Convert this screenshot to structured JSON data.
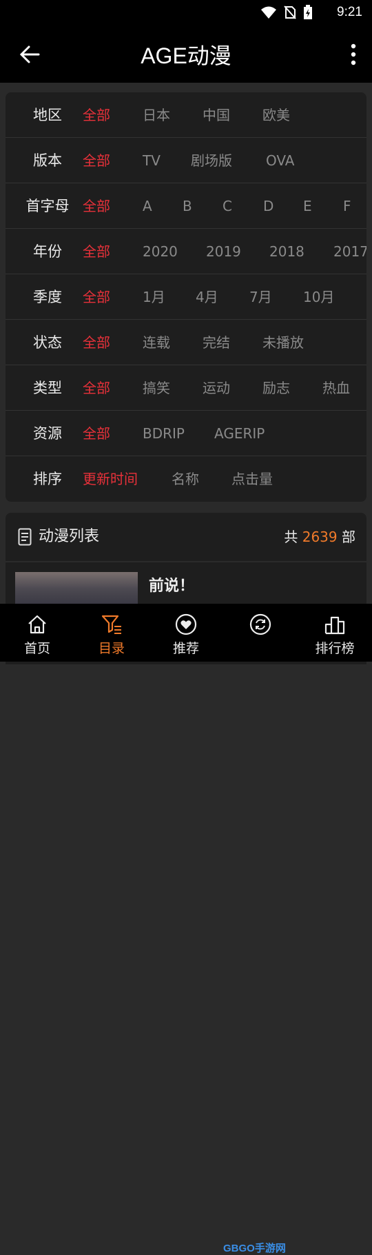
{
  "status": {
    "time": "9:21"
  },
  "app_bar": {
    "title": "AGE动漫"
  },
  "filters": [
    {
      "label": "地区",
      "options": [
        "全部",
        "日本",
        "中国",
        "欧美"
      ]
    },
    {
      "label": "版本",
      "options": [
        "全部",
        "TV",
        "剧场版",
        "OVA"
      ]
    },
    {
      "label": "首字母",
      "options": [
        "全部",
        "A",
        "B",
        "C",
        "D",
        "E",
        "F"
      ]
    },
    {
      "label": "年份",
      "options": [
        "全部",
        "2020",
        "2019",
        "2018",
        "2017"
      ]
    },
    {
      "label": "季度",
      "options": [
        "全部",
        "1月",
        "4月",
        "7月",
        "10月"
      ]
    },
    {
      "label": "状态",
      "options": [
        "全部",
        "连载",
        "完结",
        "未播放"
      ]
    },
    {
      "label": "类型",
      "options": [
        "全部",
        "搞笑",
        "运动",
        "励志",
        "热血"
      ]
    },
    {
      "label": "资源",
      "options": [
        "全部",
        "BDRIP",
        "AGERIP"
      ]
    },
    {
      "label": "排序",
      "options": [
        "更新时间",
        "名称",
        "点击量"
      ]
    }
  ],
  "list": {
    "title": "动漫列表",
    "count_prefix": "共",
    "count": "2639",
    "count_suffix": "部",
    "first_item_title": "前说！"
  },
  "bottom_nav": [
    {
      "label": "首页",
      "icon": "home-icon"
    },
    {
      "label": "目录",
      "icon": "filter-list-icon",
      "active": true
    },
    {
      "label": "推荐",
      "icon": "heart-icon"
    },
    {
      "label": "",
      "icon": "refresh-icon"
    },
    {
      "label": "排行榜",
      "icon": "ranking-icon"
    }
  ],
  "watermark": "GBGO手游网",
  "colors": {
    "accent_red": "#e8313a",
    "accent_orange": "#f07a2a"
  }
}
